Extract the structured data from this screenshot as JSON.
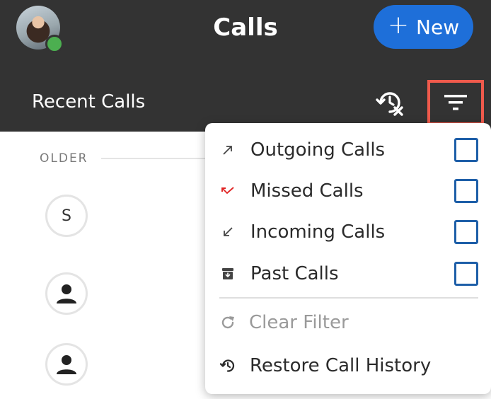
{
  "header": {
    "title": "Calls",
    "new_button": {
      "label": "New",
      "icon": "plus-icon"
    },
    "subtitle": "Recent Calls",
    "presence_status": "online"
  },
  "list": {
    "section_label": "OLDER",
    "contacts": [
      {
        "initial": "S"
      },
      {
        "icon": "person-icon"
      },
      {
        "icon": "person-icon"
      }
    ]
  },
  "filter_menu": {
    "items": [
      {
        "label": "Outgoing Calls",
        "icon": "outgoing-arrow-icon",
        "checked": false
      },
      {
        "label": "Missed Calls",
        "icon": "missed-call-icon",
        "checked": false
      },
      {
        "label": "Incoming Calls",
        "icon": "incoming-arrow-icon",
        "checked": false
      },
      {
        "label": "Past Calls",
        "icon": "archive-icon",
        "checked": false
      }
    ],
    "clear_filter": "Clear Filter",
    "restore": "Restore Call History"
  },
  "colors": {
    "header_bg": "#333333",
    "accent_blue": "#1e6fd9",
    "highlight_red": "#ef5a4c",
    "missed_red": "#e02424",
    "presence_green": "#4caf50"
  }
}
